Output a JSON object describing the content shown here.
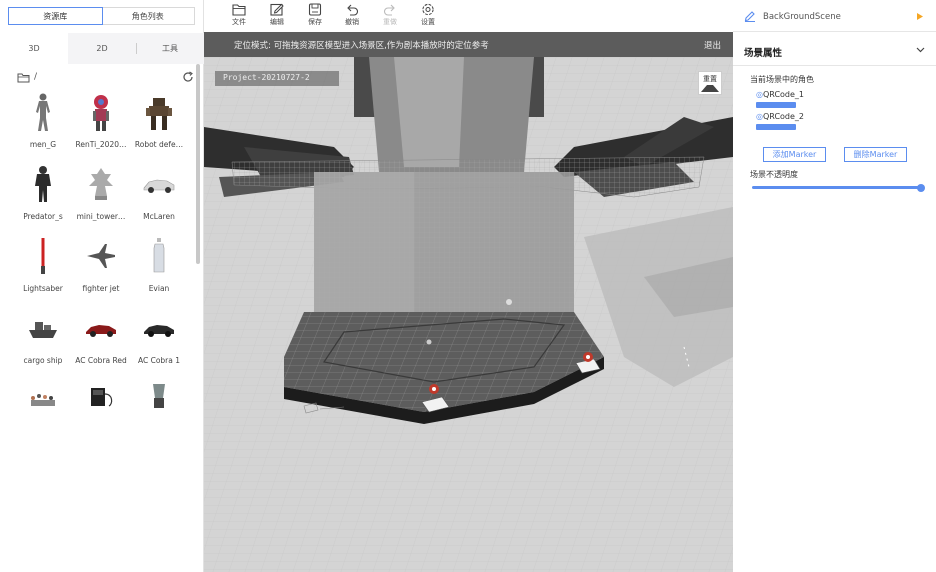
{
  "left_panel": {
    "top_tabs": [
      {
        "label": "资源库",
        "active": true
      },
      {
        "label": "角色列表",
        "active": false
      }
    ],
    "sub_tabs": [
      {
        "label": "3D",
        "active": true
      },
      {
        "label": "2D",
        "active": false
      },
      {
        "label": "工具",
        "active": false
      }
    ],
    "path": "/",
    "assets": [
      {
        "label": "men_G",
        "icon": "person-model-icon"
      },
      {
        "label": "RenTi_2020…",
        "icon": "robot-model-icon"
      },
      {
        "label": "Robot defe…",
        "icon": "mech-model-icon"
      },
      {
        "label": "Predator_s",
        "icon": "predator-model-icon"
      },
      {
        "label": "mini_tower…",
        "icon": "tower-model-icon"
      },
      {
        "label": "McLaren",
        "icon": "car-model-icon"
      },
      {
        "label": "Lightsaber",
        "icon": "lightsaber-model-icon"
      },
      {
        "label": "fighter jet",
        "icon": "jet-model-icon"
      },
      {
        "label": "Evian",
        "icon": "bottle-model-icon"
      },
      {
        "label": "cargo ship",
        "icon": "ship-model-icon"
      },
      {
        "label": "AC Cobra Red",
        "icon": "red-car-model-icon"
      },
      {
        "label": "AC Cobra 1",
        "icon": "dark-car-model-icon"
      },
      {
        "label": "",
        "icon": "chess-model-icon"
      },
      {
        "label": "",
        "icon": "machine-model-icon"
      },
      {
        "label": "",
        "icon": "blender-model-icon"
      }
    ]
  },
  "toolbar": {
    "items": [
      {
        "label": "文件",
        "icon": "folder-icon",
        "disabled": false
      },
      {
        "label": "编辑",
        "icon": "edit-icon",
        "disabled": false
      },
      {
        "label": "保存",
        "icon": "save-icon",
        "disabled": false
      },
      {
        "label": "撤销",
        "icon": "undo-icon",
        "disabled": false
      },
      {
        "label": "重做",
        "icon": "redo-icon",
        "disabled": true
      },
      {
        "label": "设置",
        "icon": "gear-icon",
        "disabled": false
      }
    ]
  },
  "viewport": {
    "mode_text": "定位模式: 可拖拽资源区模型进入场景区,作为剧本播放时的定位参考",
    "exit_label": "退出",
    "project_label": "Project-20210727-2",
    "reset_label": "重置"
  },
  "right_panel": {
    "scene_name": "BackGroundScene",
    "properties_title": "场景属性",
    "roles_title": "当前场景中的角色",
    "roles": [
      {
        "name": "QRCode_1"
      },
      {
        "name": "QRCode_2"
      }
    ],
    "add_marker_label": "添加Marker",
    "remove_marker_label": "删除Marker",
    "opacity_label": "场景不透明度",
    "opacity_value": 1.0
  },
  "colors": {
    "accent": "#5b8def",
    "play": "#f5a623"
  }
}
